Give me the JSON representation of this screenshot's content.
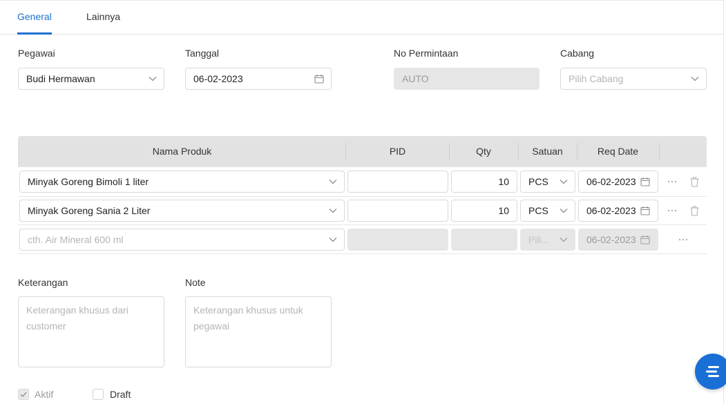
{
  "tabs": [
    {
      "label": "General",
      "active": true
    },
    {
      "label": "Lainnya",
      "active": false
    }
  ],
  "form": {
    "pegawai": {
      "label": "Pegawai",
      "value": "Budi Hermawan"
    },
    "tanggal": {
      "label": "Tanggal",
      "value": "06-02-2023"
    },
    "no_permintaan": {
      "label": "No Permintaan",
      "value": "AUTO"
    },
    "cabang": {
      "label": "Cabang",
      "placeholder": "Pilih Cabang"
    }
  },
  "table": {
    "headers": [
      "Nama Produk",
      "PID",
      "Qty",
      "Satuan",
      "Req Date"
    ],
    "rows": [
      {
        "product": "Minyak Goreng Bimoli 1 liter",
        "pid": "",
        "qty": "10",
        "unit": "PCS",
        "date": "06-02-2023"
      },
      {
        "product": "Minyak Goreng Sania 2 Liter",
        "pid": "",
        "qty": "10",
        "unit": "PCS",
        "date": "06-02-2023"
      }
    ],
    "new_row": {
      "product_placeholder": "cth. Air Mineral 600 ml",
      "unit_placeholder": "Pili...",
      "date": "06-02-2023"
    }
  },
  "notes": {
    "keterangan": {
      "label": "Keterangan",
      "placeholder": "Keterangan khusus dari customer"
    },
    "note": {
      "label": "Note",
      "placeholder": "Keterangan khusus untuk pegawai"
    }
  },
  "checkboxes": {
    "aktif": {
      "label": "Aktif",
      "checked": true
    },
    "draft": {
      "label": "Draft",
      "checked": false
    }
  },
  "colors": {
    "accent": "#1f6fd1",
    "fab": "#1a6fd6",
    "header_bg": "#e2e2e2",
    "disabled_bg": "#e6e6e6"
  },
  "icons": {
    "dropdown": "chevron-down-icon",
    "date": "calendar-icon",
    "more": "ellipsis-icon",
    "delete": "trash-icon",
    "fab": "menu-icon"
  }
}
